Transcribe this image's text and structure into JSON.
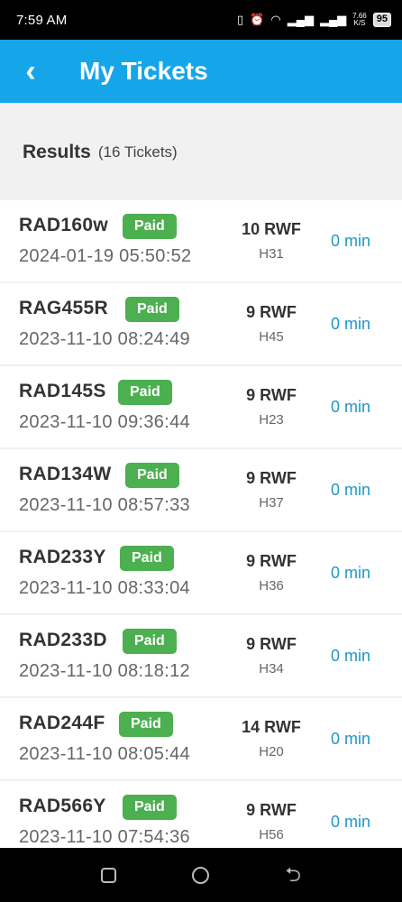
{
  "status": {
    "time": "7:59 AM",
    "net_speed_top": "7.66",
    "net_speed_unit": "K/S",
    "battery": "95"
  },
  "header": {
    "title": "My Tickets"
  },
  "results": {
    "label": "Results",
    "count": "(16 Tickets)"
  },
  "tickets": [
    {
      "plate": "RAD160w",
      "status": "Paid",
      "datetime": "2024-01-19 05:50:52",
      "amount": "10 RWF",
      "slot": "H31",
      "duration": "0 min"
    },
    {
      "plate": "RAG455R",
      "status": "Paid",
      "datetime": "2023-11-10 08:24:49",
      "amount": "9 RWF",
      "slot": "H45",
      "duration": "0 min"
    },
    {
      "plate": "RAD145S",
      "status": "Paid",
      "datetime": "2023-11-10 09:36:44",
      "amount": "9 RWF",
      "slot": "H23",
      "duration": "0 min"
    },
    {
      "plate": "RAD134W",
      "status": "Paid",
      "datetime": "2023-11-10 08:57:33",
      "amount": "9 RWF",
      "slot": "H37",
      "duration": "0 min"
    },
    {
      "plate": "RAD233Y",
      "status": "Paid",
      "datetime": "2023-11-10 08:33:04",
      "amount": "9 RWF",
      "slot": "H36",
      "duration": "0 min"
    },
    {
      "plate": "RAD233D",
      "status": "Paid",
      "datetime": "2023-11-10 08:18:12",
      "amount": "9 RWF",
      "slot": "H34",
      "duration": "0 min"
    },
    {
      "plate": "RAD244F",
      "status": "Paid",
      "datetime": "2023-11-10 08:05:44",
      "amount": "14 RWF",
      "slot": "H20",
      "duration": "0 min"
    },
    {
      "plate": "RAD566Y",
      "status": "Paid",
      "datetime": "2023-11-10 07:54:36",
      "amount": "9 RWF",
      "slot": "H56",
      "duration": "0 min"
    }
  ],
  "colors": {
    "appbar": "#14a6e8",
    "paid_badge": "#4caf50",
    "duration_text": "#2196c9"
  },
  "icons": {
    "back": "arrow-left-icon",
    "nav_recents": "square-icon",
    "nav_home": "circle-icon",
    "nav_back": "return-icon"
  }
}
